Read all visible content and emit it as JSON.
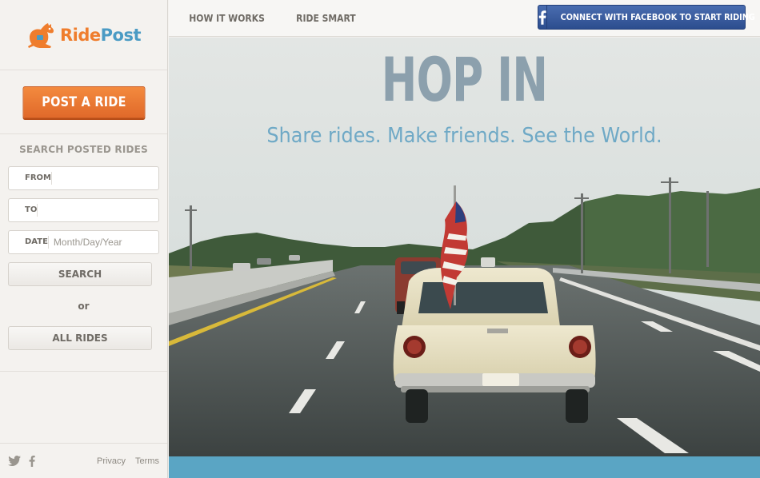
{
  "brand": {
    "name_part1": "Ride",
    "name_part2": "Post",
    "accent": "#ef7d2d",
    "secondary": "#4a9bc4"
  },
  "sidebar": {
    "post_ride_label": "POST A RIDE",
    "search": {
      "title": "SEARCH POSTED RIDES",
      "from_label": "FROM",
      "from_value": "",
      "to_label": "TO",
      "to_value": "",
      "date_label": "DATE",
      "date_placeholder": "Month/Day/Year",
      "search_button": "SEARCH",
      "or_text": "or",
      "all_rides_button": "ALL RIDES"
    },
    "footer": {
      "social_icons": [
        "twitter-icon",
        "facebook-icon"
      ],
      "privacy_label": "Privacy",
      "terms_label": "Terms"
    }
  },
  "nav": {
    "how_it_works": "HOW IT WORKS",
    "ride_smart": "RIDE SMART",
    "facebook_button": "CONNECT WITH FACEBOOK TO START RIDING",
    "facebook_color": "#3b5b9b"
  },
  "hero": {
    "title": "HOP IN",
    "subtitle": "Share rides. Make friends. See the World."
  }
}
